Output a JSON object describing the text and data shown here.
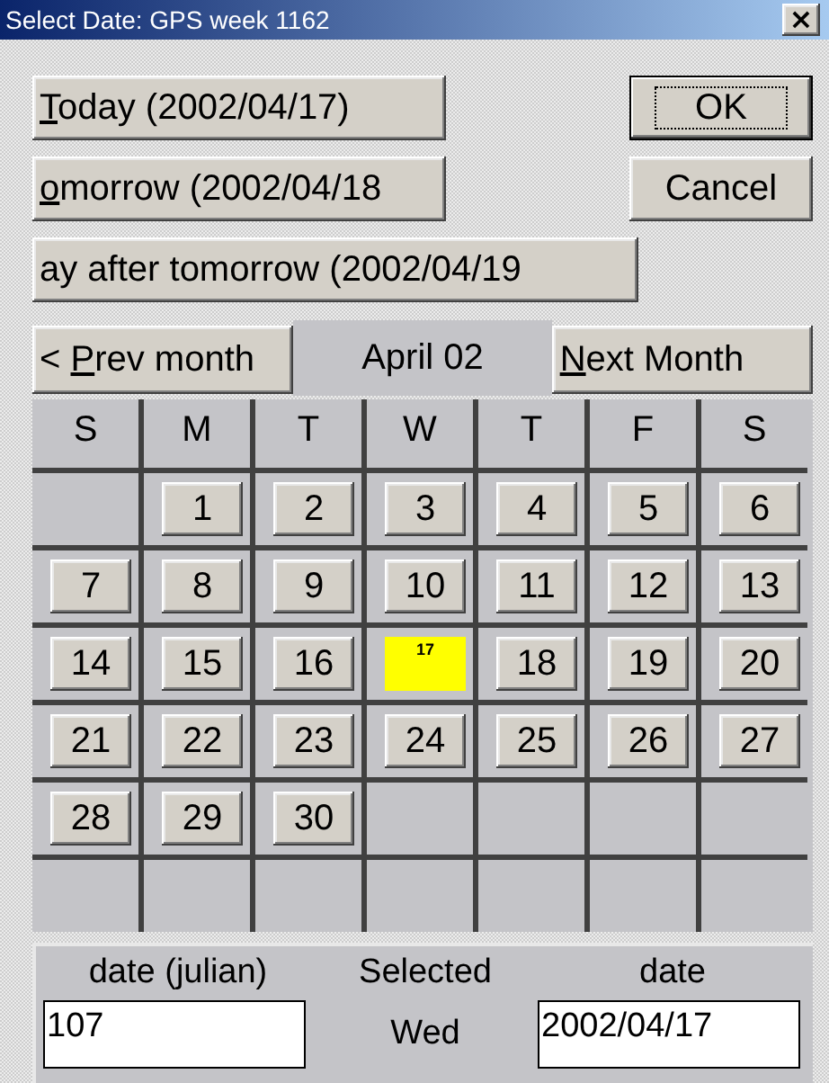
{
  "window": {
    "title": "Select Date: GPS week 1162",
    "close_glyph": "×"
  },
  "quick_buttons": [
    {
      "mnemonic": "T",
      "after": "oday (2002/04/17)"
    },
    {
      "mnemonic": "o",
      "after": "morrow (2002/04/18"
    },
    {
      "before": "ay after tomorrow (2002/04/19"
    }
  ],
  "action_buttons": [
    {
      "label": "OK",
      "default": true
    },
    {
      "label": "Cancel",
      "default": false
    }
  ],
  "navigation": {
    "prev": {
      "before": "< ",
      "mnemonic": "P",
      "after": "rev month"
    },
    "month": "April 02",
    "next": {
      "mnemonic": "N",
      "after": "ext Month"
    }
  },
  "weekdays": [
    "S",
    "M",
    "T",
    "W",
    "T",
    "F",
    "S"
  ],
  "weeks": [
    [
      {
        "kind": "empty"
      },
      {
        "kind": "day",
        "label": "1",
        "selected": false
      },
      {
        "kind": "day",
        "label": "2",
        "selected": false
      },
      {
        "kind": "day",
        "label": "3",
        "selected": false
      },
      {
        "kind": "day",
        "label": "4",
        "selected": false
      },
      {
        "kind": "day",
        "label": "5",
        "selected": false
      },
      {
        "kind": "day",
        "label": "6",
        "selected": false
      }
    ],
    [
      {
        "kind": "day",
        "label": "7",
        "selected": false
      },
      {
        "kind": "day",
        "label": "8",
        "selected": false
      },
      {
        "kind": "day",
        "label": "9",
        "selected": false
      },
      {
        "kind": "day",
        "label": "10",
        "selected": false
      },
      {
        "kind": "day",
        "label": "11",
        "selected": false
      },
      {
        "kind": "day",
        "label": "12",
        "selected": false
      },
      {
        "kind": "day",
        "label": "13",
        "selected": false
      }
    ],
    [
      {
        "kind": "day",
        "label": "14",
        "selected": false
      },
      {
        "kind": "day",
        "label": "15",
        "selected": false
      },
      {
        "kind": "day",
        "label": "16",
        "selected": false
      },
      {
        "kind": "day",
        "label": "17",
        "selected": true
      },
      {
        "kind": "day",
        "label": "18",
        "selected": false
      },
      {
        "kind": "day",
        "label": "19",
        "selected": false
      },
      {
        "kind": "day",
        "label": "20",
        "selected": false
      }
    ],
    [
      {
        "kind": "day",
        "label": "21",
        "selected": false
      },
      {
        "kind": "day",
        "label": "22",
        "selected": false
      },
      {
        "kind": "day",
        "label": "23",
        "selected": false
      },
      {
        "kind": "day",
        "label": "24",
        "selected": false
      },
      {
        "kind": "day",
        "label": "25",
        "selected": false
      },
      {
        "kind": "day",
        "label": "26",
        "selected": false
      },
      {
        "kind": "day",
        "label": "27",
        "selected": false
      }
    ],
    [
      {
        "kind": "day",
        "label": "28",
        "selected": false
      },
      {
        "kind": "day",
        "label": "29",
        "selected": false
      },
      {
        "kind": "day",
        "label": "30",
        "selected": false
      },
      {
        "kind": "empty"
      },
      {
        "kind": "empty"
      },
      {
        "kind": "empty"
      },
      {
        "kind": "empty"
      }
    ],
    [
      {
        "kind": "empty"
      },
      {
        "kind": "empty"
      },
      {
        "kind": "empty"
      },
      {
        "kind": "empty"
      },
      {
        "kind": "empty"
      },
      {
        "kind": "empty"
      },
      {
        "kind": "empty"
      }
    ]
  ],
  "footer": {
    "julian_label": "date (julian)",
    "julian_value": "107",
    "selected_label": "Selected",
    "selected_weekday": "Wed",
    "date_label": "date",
    "date_value": "2002/04/17"
  }
}
